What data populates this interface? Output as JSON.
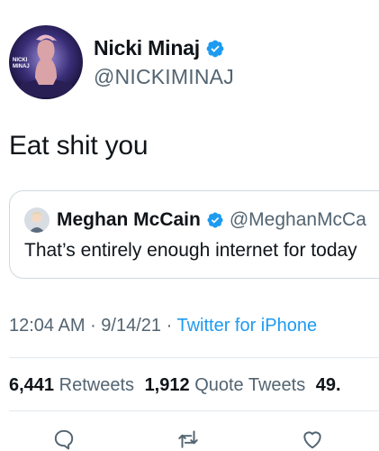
{
  "tweet": {
    "author": {
      "display_name": "Nicki Minaj",
      "handle": "@NICKIMINAJ",
      "avatar_text": "NICKI MINAJ",
      "verified": true
    },
    "text": "Eat shit you",
    "quote": {
      "author": {
        "display_name": "Meghan McCain",
        "handle": "@MeghanMcCa",
        "verified": true
      },
      "text": "That’s entirely enough internet for today"
    },
    "meta": {
      "time": "12:04 AM",
      "separator": " · ",
      "date": "9/14/21",
      "source": "Twitter for iPhone"
    },
    "stats": {
      "retweets_count": "6,441",
      "retweets_label": "Retweets",
      "quotes_count": "1,912",
      "quotes_label": "Quote Tweets",
      "likes_count": "49."
    }
  },
  "colors": {
    "accent": "#1d9bf0",
    "secondary_text": "#536471",
    "border": "#cfd9de"
  },
  "icons": [
    "verified-badge-icon",
    "reply-icon",
    "retweet-icon",
    "like-icon"
  ]
}
